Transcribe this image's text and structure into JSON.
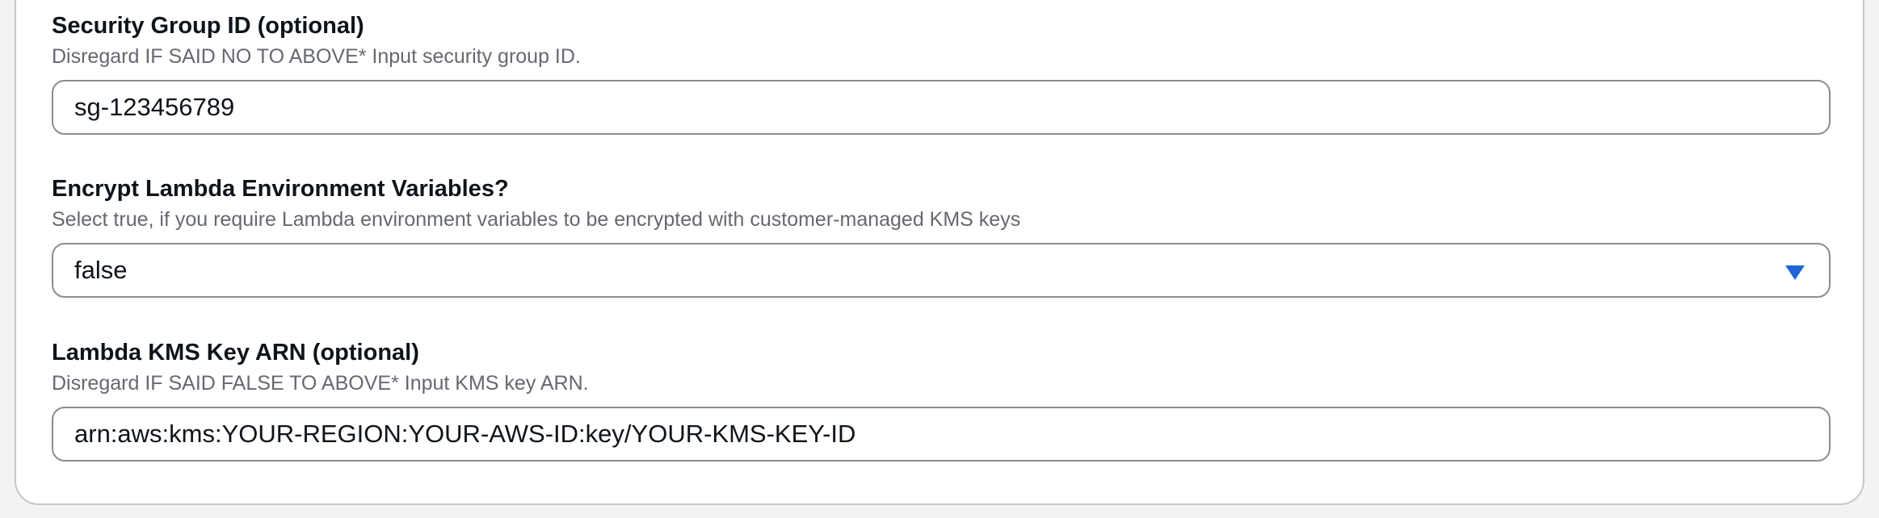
{
  "fields": [
    {
      "label": "Security Group ID (optional)",
      "description": "Disregard IF SAID NO TO ABOVE* Input security group ID.",
      "type": "text",
      "value": "sg-123456789"
    },
    {
      "label": "Encrypt Lambda Environment Variables?",
      "description": "Select true, if you require Lambda environment variables to be encrypted with customer-managed KMS keys",
      "type": "select",
      "value": "false",
      "caret_icon": "triangle-down",
      "caret_color": "#1f65d6"
    },
    {
      "label": "Lambda KMS Key ARN (optional)",
      "description": "Disregard IF SAID FALSE TO ABOVE* Input KMS key ARN.",
      "type": "text",
      "value": "arn:aws:kms:YOUR-REGION:YOUR-AWS-ID:key/YOUR-KMS-KEY-ID"
    }
  ]
}
